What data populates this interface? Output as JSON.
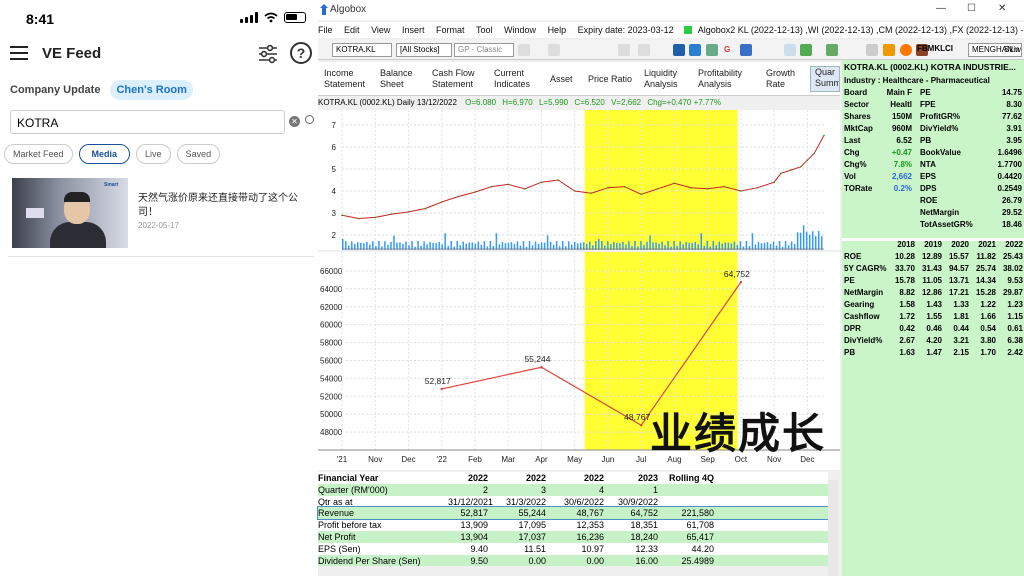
{
  "phone": {
    "time": "8:41",
    "title": "VE Feed",
    "help_glyph": "?",
    "tabs": [
      "Company Update",
      "Chen's Room"
    ],
    "search_value": "KOTRA",
    "pills": [
      "Market Feed",
      "Media",
      "Live",
      "Saved"
    ],
    "item": {
      "title": "天然气涨价原来还直接带动了这个公司！",
      "date": "2022-05-17",
      "thumb_logo": "Smart"
    }
  },
  "algo": {
    "title": "Algobox",
    "menus": [
      "File",
      "Edit",
      "View",
      "Insert",
      "Format",
      "Tool",
      "Window",
      "Help"
    ],
    "expiry": "Expiry date: 2023-03-12",
    "ticker_line": "Algobox2 KL (2022-12-13) ,WI (2022-12-13) ,CM (2022-12-13) ,FX (2022-12-13)  -> H",
    "toolbar": {
      "stock": "KOTRA.KL",
      "filter": "[All Stocks]",
      "gp": "GP - Classic",
      "index": "FBMKLCI",
      "user": "MENGHAN.wls",
      "skin": "Skin"
    },
    "tabs": [
      {
        "l1": "Income",
        "l2": "Statement"
      },
      {
        "l1": "Balance",
        "l2": "Sheet"
      },
      {
        "l1": "Cash Flow",
        "l2": "Statement"
      },
      {
        "l1": "Current",
        "l2": "Indicates"
      },
      {
        "l1": "Asset",
        "l2": ""
      },
      {
        "l1": "Price Ratio",
        "l2": ""
      },
      {
        "l1": "Liquidity",
        "l2": "Analysis"
      },
      {
        "l1": "Profitability",
        "l2": "Analysis"
      },
      {
        "l1": "Growth",
        "l2": "Rate"
      },
      {
        "l1": "Quar",
        "l2": "Summ"
      }
    ],
    "price_header": {
      "name": "KOTRA.KL (0002.KL) Daily  13/12/2022",
      "o": "O=6.080",
      "h": "H=6.970",
      "l": "L=5.990",
      "c": "C=6.520",
      "v": "V=2,662",
      "chg": "Chg=+0.470  +7.77%"
    },
    "overlay_text": "业绩成长",
    "colors": {
      "highlight": "#ffff33",
      "panel": "#c9f5c9",
      "green_row": "#c7f2c7",
      "line": "#e0453a",
      "vol": "#3399ff",
      "price": "#cc2222"
    }
  },
  "chart_data": [
    {
      "type": "line",
      "title": "KOTRA.KL (0002.KL) Daily 13/12/2022",
      "xlabel": "",
      "ylabel": "",
      "ylim": [
        1.5,
        7.5
      ],
      "yticks": [
        2,
        3,
        4,
        5,
        6,
        7
      ],
      "xticks": [
        "'21",
        "Nov",
        "Dec",
        "'22",
        "Feb",
        "Mar",
        "Apr",
        "May",
        "Jun",
        "Jul",
        "Aug",
        "Sep",
        "Oct",
        "Nov",
        "Dec"
      ],
      "x": [
        0,
        0.5,
        1,
        1.5,
        2,
        2.5,
        3,
        3.5,
        4,
        4.5,
        5,
        5.5,
        6,
        6.5,
        7,
        7.5,
        8,
        8.5,
        9,
        9.5,
        10,
        10.5,
        11,
        11.5,
        12,
        12.5,
        13,
        13.2,
        13.5,
        13.8,
        14,
        14.2,
        14.5
      ],
      "values": [
        2.9,
        2.75,
        2.8,
        2.95,
        3.05,
        3.2,
        3.5,
        3.75,
        3.95,
        4.2,
        4.3,
        4.1,
        4.4,
        4.5,
        4.0,
        3.9,
        4.15,
        4.2,
        3.85,
        4.1,
        4.35,
        4.15,
        4.1,
        4.2,
        4.0,
        4.15,
        4.4,
        4.8,
        4.95,
        5.1,
        5.4,
        5.7,
        6.52
      ],
      "highlight_x": [
        7.3,
        11.9
      ]
    },
    {
      "type": "line",
      "series": [
        {
          "name": "Revenue",
          "values": [
            52817,
            55244,
            48767,
            64752
          ]
        }
      ],
      "x": [
        3.0,
        6.0,
        9.0,
        12.0
      ],
      "labels": [
        "52,817",
        "55,244",
        "48,767",
        "64,752"
      ],
      "ylim": [
        46000,
        67000
      ],
      "yticks": [
        48000,
        50000,
        52000,
        54000,
        56000,
        58000,
        60000,
        62000,
        64000,
        66000
      ],
      "ytick_labels": [
        "48000",
        "50000",
        "52000",
        "54000",
        "56000",
        "58000",
        "60000",
        "62000",
        "64000",
        "66000"
      ],
      "xticks": [
        "'21",
        "Nov",
        "Dec",
        "'22",
        "Feb",
        "Mar",
        "Apr",
        "May",
        "Jun",
        "Jul",
        "Aug",
        "Sep",
        "Oct",
        "Nov",
        "Dec"
      ],
      "highlight_x": [
        7.3,
        11.9
      ]
    }
  ],
  "fin_table": {
    "cols": [
      "Financial Year",
      "2022",
      "2022",
      "2022",
      "2023",
      "Rolling 4Q"
    ],
    "rows": [
      [
        "Quarter (RM'000)",
        "2",
        "3",
        "4",
        "1",
        ""
      ],
      [
        "Qtr as at",
        "31/12/2021",
        "31/3/2022",
        "30/6/2022",
        "30/9/2022",
        ""
      ],
      [
        "Revenue",
        "52,817",
        "55,244",
        "48,767",
        "64,752",
        "221,580"
      ],
      [
        "Profit before tax",
        "13,909",
        "17,095",
        "12,353",
        "18,351",
        "61,708"
      ],
      [
        "Net Profit",
        "13,904",
        "17,037",
        "16,236",
        "18,240",
        "65,417"
      ],
      [
        "EPS (Sen)",
        "9.40",
        "11.51",
        "10.97",
        "12.33",
        "44.20"
      ],
      [
        "Dividend Per Share (Sen)",
        "9.50",
        "0.00",
        "0.00",
        "16.00",
        "25.4989"
      ]
    ]
  },
  "right_panel": {
    "title": "KOTRA.KL (0002.KL) KOTRA INDUSTRIE...",
    "industry": "Industry : Healthcare - Pharmaceutical",
    "rows": [
      [
        "Board",
        "Main F",
        "PE",
        "14.75"
      ],
      [
        "Sector",
        "Healtl",
        "FPE",
        "8.30"
      ],
      [
        "Shares",
        "150M",
        "ProfitGR%",
        "77.62"
      ],
      [
        "MktCap",
        "960M",
        "DivYield%",
        "3.91"
      ],
      [
        "Last",
        "6.52",
        "PB",
        "3.95"
      ],
      [
        "Chg",
        "+0.47",
        "BookValue",
        "1.6496"
      ],
      [
        "Chg%",
        "7.8%",
        "NTA",
        "1.7700"
      ],
      [
        "Vol",
        "2,662",
        "EPS",
        "0.4420"
      ],
      [
        "TORate",
        "0.2%",
        "DPS",
        "0.2549"
      ],
      [
        "",
        "",
        "ROE",
        "26.79"
      ],
      [
        "",
        "",
        "NetMargin",
        "29.52"
      ],
      [
        "",
        "",
        "TotAssetGR%",
        "18.46"
      ]
    ],
    "years": [
      "2018",
      "2019",
      "2020",
      "2021",
      "2022"
    ],
    "ratios": [
      [
        "ROE",
        "10.28",
        "12.89",
        "15.57",
        "11.82",
        "25.43"
      ],
      [
        "5Y CAGR%",
        "33.70",
        "31.43",
        "94.57",
        "25.74",
        "38.02"
      ],
      [
        "PE",
        "15.78",
        "11.05",
        "13.71",
        "14.34",
        "9.53"
      ],
      [
        "NetMargin",
        "8.82",
        "12.86",
        "17.21",
        "15.28",
        "29.87"
      ],
      [
        "Gearing",
        "1.58",
        "1.43",
        "1.33",
        "1.22",
        "1.23"
      ],
      [
        "Cashflow",
        "1.72",
        "1.55",
        "1.81",
        "1.66",
        "1.15"
      ],
      [
        "DPR",
        "0.42",
        "0.46",
        "0.44",
        "0.54",
        "0.61"
      ],
      [
        "DivYield%",
        "2.67",
        "4.20",
        "3.21",
        "3.80",
        "6.38"
      ],
      [
        "PB",
        "1.63",
        "1.47",
        "2.15",
        "1.70",
        "2.42"
      ]
    ]
  }
}
